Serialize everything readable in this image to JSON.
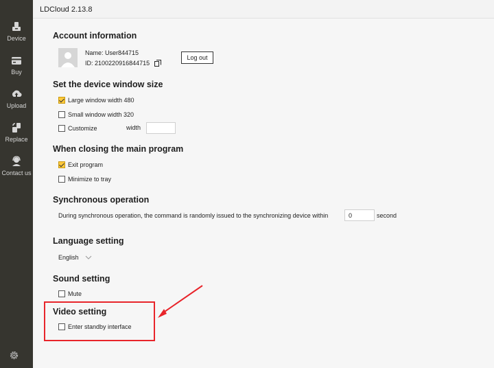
{
  "app": {
    "title": "LDCloud 2.13.8"
  },
  "sidebar": {
    "items": [
      {
        "label": "Device",
        "icon": "device-icon"
      },
      {
        "label": "Buy",
        "icon": "wallet-icon"
      },
      {
        "label": "Upload",
        "icon": "upload-icon"
      },
      {
        "label": "Replace",
        "icon": "replace-icon"
      },
      {
        "label": "Contact us",
        "icon": "headset-icon"
      }
    ],
    "settings_icon": "gear-icon",
    "background": "#36352f"
  },
  "account": {
    "title": "Account information",
    "name_label": "Name:",
    "name_value": "User844715",
    "id_label": "ID:",
    "id_value": "2100220916844715",
    "logout_label": "Log out"
  },
  "window_size": {
    "title": "Set the device window size",
    "options": [
      {
        "label": "Large window width 480",
        "checked": true
      },
      {
        "label": "Small window width 320",
        "checked": false
      },
      {
        "label": "Customize",
        "checked": false
      }
    ],
    "width_label": "width",
    "width_value": ""
  },
  "closing": {
    "title": "When closing the main program",
    "options": [
      {
        "label": "Exit program",
        "checked": true
      },
      {
        "label": "Minimize to tray",
        "checked": false
      }
    ]
  },
  "sync": {
    "title": "Synchronous operation",
    "text": "During synchronous operation, the command is randomly issued to the synchronizing device within",
    "value": "0",
    "unit": "second"
  },
  "language": {
    "title": "Language setting",
    "selected": "English"
  },
  "sound": {
    "title": "Sound setting",
    "mute_label": "Mute",
    "mute_checked": false
  },
  "video": {
    "title": "Video setting",
    "standby_label": "Enter standby interface",
    "standby_checked": false
  },
  "colors": {
    "accent_checkbox": "#ffc93c",
    "annotation_red": "#e8242a"
  }
}
